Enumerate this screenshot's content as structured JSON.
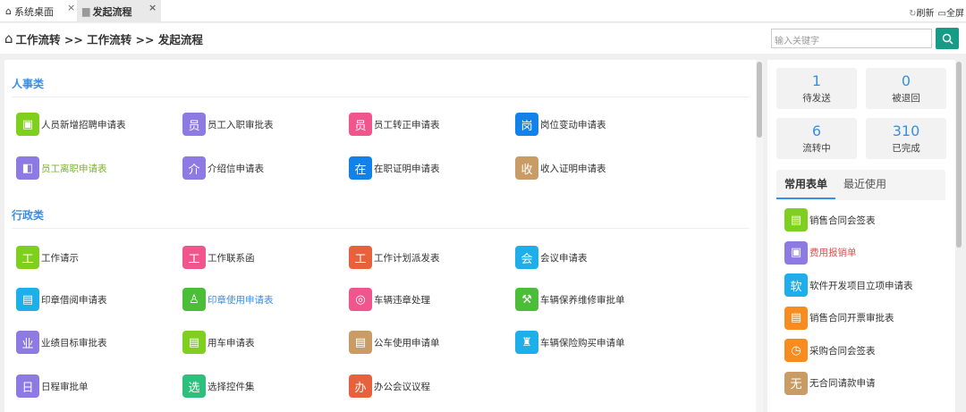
{
  "tabs": [
    {
      "label": "系统桌面",
      "icon": "home-icon"
    },
    {
      "label": "发起流程",
      "icon": "document-icon"
    }
  ],
  "tools": {
    "refresh": "刷新",
    "fullscreen": "全屏"
  },
  "breadcrumb": "工作流转 >> 工作流转 >> 发起流程",
  "search": {
    "placeholder": "输入关键字",
    "value": ""
  },
  "colors": {
    "accent": "#3a8ee6",
    "search_button": "#169c86"
  },
  "sections": [
    {
      "title": "人事类",
      "items": [
        {
          "label": "人员新增招聘申请表",
          "glyph": "▣",
          "color": "#7fcf1e"
        },
        {
          "label": "员工入职审批表",
          "glyph": "员",
          "color": "#8d7be3"
        },
        {
          "label": "员工转正申请表",
          "glyph": "员",
          "color": "#f0568b"
        },
        {
          "label": "岗位变动申请表",
          "glyph": "岗",
          "color": "#1282e8"
        },
        {
          "label": "员工离职申请表",
          "glyph": "◧",
          "color": "#8d7be3",
          "text_color": "#7ab32e"
        },
        {
          "label": "介绍信申请表",
          "glyph": "介",
          "color": "#8d7be3"
        },
        {
          "label": "在职证明申请表",
          "glyph": "在",
          "color": "#1282e8"
        },
        {
          "label": "收入证明申请表",
          "glyph": "收",
          "color": "#c99c66"
        }
      ]
    },
    {
      "title": "行政类",
      "items": [
        {
          "label": "工作请示",
          "glyph": "工",
          "color": "#7fcf1e"
        },
        {
          "label": "工作联系函",
          "glyph": "工",
          "color": "#f0568b"
        },
        {
          "label": "工作计划派发表",
          "glyph": "工",
          "color": "#e7613d"
        },
        {
          "label": "会议申请表",
          "glyph": "会",
          "color": "#1eaeea"
        },
        {
          "label": "印章借阅申请表",
          "glyph": "▤",
          "color": "#1eaeea"
        },
        {
          "label": "印章使用申请表",
          "glyph": "♙",
          "color": "#4cbd39",
          "text_color": "#3a8ee6"
        },
        {
          "label": "车辆违章处理",
          "glyph": "◎",
          "color": "#f0568b"
        },
        {
          "label": "车辆保养维修审批单",
          "glyph": "⚒",
          "color": "#4cbd39"
        },
        {
          "label": "业绩目标审批表",
          "glyph": "业",
          "color": "#8d7be3"
        },
        {
          "label": "用车申请表",
          "glyph": "▤",
          "color": "#7fcf1e"
        },
        {
          "label": "公车使用申请单",
          "glyph": "▤",
          "color": "#c99c66"
        },
        {
          "label": "车辆保险购买申请单",
          "glyph": "♜",
          "color": "#1eaeea"
        },
        {
          "label": "日程审批单",
          "glyph": "日",
          "color": "#8d7be3"
        },
        {
          "label": "选择控件集",
          "glyph": "选",
          "color": "#2dc07d"
        },
        {
          "label": "办公会议议程",
          "glyph": "办",
          "color": "#e7613d"
        }
      ]
    }
  ],
  "stats": [
    {
      "value": "1",
      "label": "待发送"
    },
    {
      "value": "0",
      "label": "被退回"
    },
    {
      "value": "6",
      "label": "流转中"
    },
    {
      "value": "310",
      "label": "已完成"
    }
  ],
  "side_tabs": [
    {
      "label": "常用表单",
      "active": true
    },
    {
      "label": "最近使用",
      "active": false
    }
  ],
  "favorites": [
    {
      "label": "销售合同会签表",
      "glyph": "▤",
      "color": "#7fcf1e"
    },
    {
      "label": "费用报销单",
      "glyph": "▣",
      "color": "#8d7be3",
      "text_color": "#d9534f"
    },
    {
      "label": "软件开发项目立项申请表",
      "glyph": "软",
      "color": "#1eaeea"
    },
    {
      "label": "销售合同开票审批表",
      "glyph": "▤",
      "color": "#f98c1f"
    },
    {
      "label": "采购合同会签表",
      "glyph": "◷",
      "color": "#f98c1f"
    },
    {
      "label": "无合同请款申请",
      "glyph": "无",
      "color": "#c99c66"
    }
  ]
}
